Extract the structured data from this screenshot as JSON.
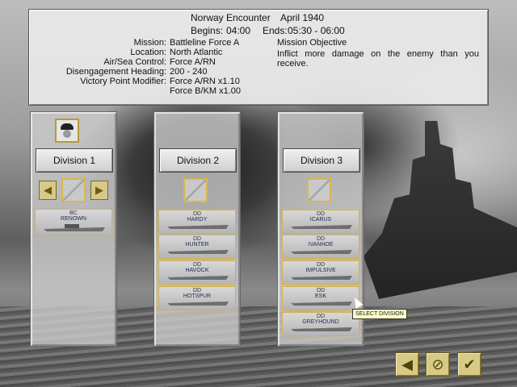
{
  "header": {
    "title": "Norway Encounter",
    "date": "April 1940",
    "begins_label": "Begins:",
    "begins": "04:00",
    "ends_label": "Ends:",
    "ends": "05:30  -  06:00"
  },
  "mission": {
    "labels": [
      "Mission:",
      "Location:",
      "Air/Sea Control:",
      "Disengagement Heading:",
      "Victory Point Modifier:"
    ],
    "values": [
      "Battleline Force A",
      "North Atlantic",
      "Force A/RN",
      "200  -  240",
      "Force A/RN  x1.10",
      "Force B/KM  x1.00"
    ],
    "objective_title": "Mission Objective",
    "objective_text": "Inflict more damage on the enemy than you receive."
  },
  "divisions": [
    {
      "label": "Division  1",
      "ships": [
        {
          "cls": "BC",
          "name": "RENOWN"
        }
      ]
    },
    {
      "label": "Division  2",
      "ships": [
        {
          "cls": "DD",
          "name": "HARDY"
        },
        {
          "cls": "DD",
          "name": "HUNTER"
        },
        {
          "cls": "DD",
          "name": "HAVOCK"
        },
        {
          "cls": "DD",
          "name": "HOTSPUR"
        }
      ]
    },
    {
      "label": "Division  3",
      "ships": [
        {
          "cls": "DD",
          "name": "ICARUS"
        },
        {
          "cls": "DD",
          "name": "IVANHOE"
        },
        {
          "cls": "DD",
          "name": "IMPULSIVE"
        },
        {
          "cls": "DD",
          "name": "ESK"
        },
        {
          "cls": "DD",
          "name": "GREYHOUND"
        }
      ]
    }
  ],
  "tooltip": "SELECT DIVISION",
  "controls": {
    "back_icon": "back-arrow-icon",
    "cancel_icon": "cancel-icon",
    "confirm_icon": "checkmark-icon"
  },
  "colors": {
    "accent_gold": "#d4b24a",
    "button_gold": "#d8ca84"
  }
}
